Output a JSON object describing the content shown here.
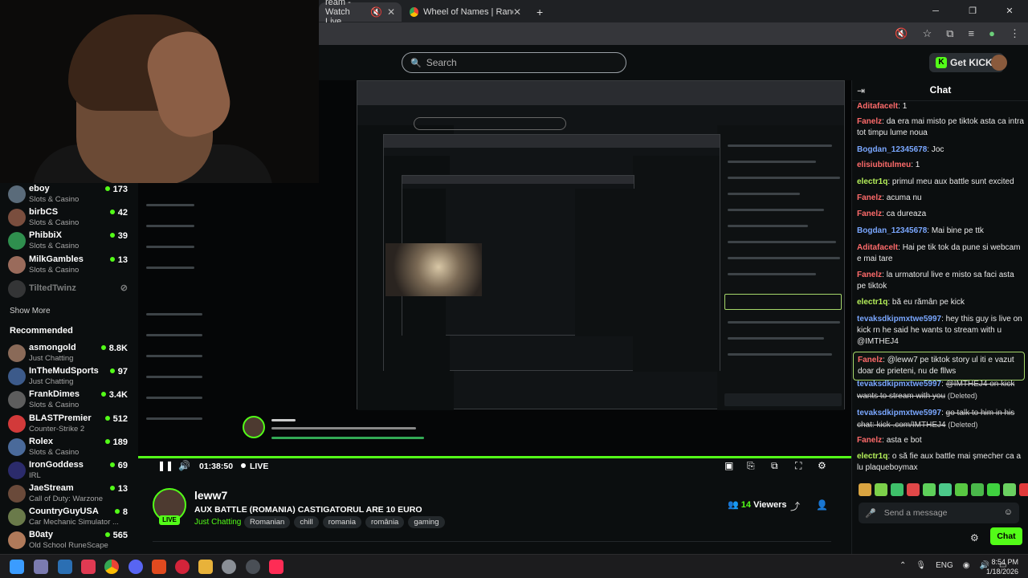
{
  "browser": {
    "tabs": [
      {
        "title": "ream - Watch Live"
      },
      {
        "title": "Wheel of Names | Random nam"
      }
    ],
    "new_tab": "+"
  },
  "header": {
    "search_placeholder": "Search",
    "kicks_label": "Get KICKs"
  },
  "sidebar": {
    "following": [
      {
        "name": "eboy",
        "category": "Slots & Casino",
        "viewers": "173",
        "color": "#5a6b7a"
      },
      {
        "name": "birbCS",
        "category": "Slots & Casino",
        "viewers": "42",
        "color": "#7a4e3e"
      },
      {
        "name": "PhibbiX",
        "category": "Slots & Casino",
        "viewers": "39",
        "color": "#2f8f4e"
      },
      {
        "name": "MilkGambles",
        "category": "Slots & Casino",
        "viewers": "13",
        "color": "#9a6b5b"
      },
      {
        "name": "TiltedTwinz",
        "category": "",
        "viewers": "",
        "color": "#444"
      }
    ],
    "show_more": "Show More",
    "recommended_title": "Recommended",
    "recommended": [
      {
        "name": "asmongold",
        "category": "Just Chatting",
        "viewers": "8.8K",
        "color": "#8a6a58"
      },
      {
        "name": "InTheMudSports",
        "category": "Just Chatting",
        "viewers": "97",
        "color": "#3c5a8a"
      },
      {
        "name": "FrankDimes",
        "category": "Slots & Casino",
        "viewers": "3.4K",
        "color": "#5d5d5d"
      },
      {
        "name": "BLASTPremier",
        "category": "Counter-Strike 2",
        "viewers": "512",
        "color": "#d23a3a"
      },
      {
        "name": "Rolex",
        "category": "Slots & Casino",
        "viewers": "189",
        "color": "#4a6a9a"
      },
      {
        "name": "IronGoddess",
        "category": "IRL",
        "viewers": "69",
        "color": "#2b2b6b"
      },
      {
        "name": "JaeStream",
        "category": "Call of Duty: Warzone",
        "viewers": "13",
        "color": "#6a4a3a"
      },
      {
        "name": "CountryGuyUSA",
        "category": "Car Mechanic Simulator ...",
        "viewers": "8",
        "color": "#6a7a4a"
      },
      {
        "name": "B0aty",
        "category": "Old School RuneScape",
        "viewers": "565",
        "color": "#b07a5a"
      }
    ]
  },
  "player": {
    "time": "01:38:50",
    "live": "LIVE"
  },
  "stream": {
    "streamer": "leww7",
    "live_badge": "LIVE",
    "title": "AUX BATTLE (ROMANIA) CASTIGATORUL ARE 10 EURO",
    "category": "Just Chatting",
    "tags": [
      "Romanian",
      "chill",
      "romania",
      "românia",
      "gaming"
    ],
    "viewers_count": "14",
    "viewers_label": "Viewers"
  },
  "chat": {
    "title": "Chat",
    "messages": [
      {
        "user": "Aditafacelt",
        "color": "#ff6b6b",
        "text": "1"
      },
      {
        "user": "Fanelz",
        "color": "#ff6b6b",
        "text": "da era mai misto pe tiktok asta ca intra tot timpu lume noua"
      },
      {
        "user": "Bogdan_12345678",
        "color": "#7aa7ff",
        "text": "Joc"
      },
      {
        "user": "elisiubitulmeu",
        "color": "#ff6b6b",
        "text": "1"
      },
      {
        "user": "electr1q",
        "color": "#b6f05a",
        "text": "primul meu aux battle sunt excited"
      },
      {
        "user": "Fanelz",
        "color": "#ff6b6b",
        "text": "acuma nu"
      },
      {
        "user": "Fanelz",
        "color": "#ff6b6b",
        "text": "ca dureaza"
      },
      {
        "user": "Bogdan_12345678",
        "color": "#7aa7ff",
        "text": "Mai bine pe ttk"
      },
      {
        "user": "Aditafacelt",
        "color": "#ff6b6b",
        "text": "Hai pe tik tok da pune si webcam e mai tare"
      },
      {
        "user": "Fanelz",
        "color": "#ff6b6b",
        "text": "la urmatorul live e misto sa faci asta pe tiktok"
      },
      {
        "user": "electr1q",
        "color": "#b6f05a",
        "text": "bă eu rămân pe kick"
      },
      {
        "user": "tevaksdkipmxtwe5997",
        "color": "#7aa7ff",
        "text": "hey this guy is live on kick rn he said he wants to stream with u @IMTHEJ4"
      },
      {
        "user": "Fanelz",
        "color": "#ff6b6b",
        "text": "@leww7 pe tiktok story ul iti e vazut doar de prieteni, nu de fllws"
      },
      {
        "user": "tevaksdkipmxtwe5997",
        "color": "#7aa7ff",
        "text": "@IMTHEJ4 on kick wants to stream with you",
        "deleted": "(Deleted)"
      },
      {
        "user": "tevaksdkipmxtwe5997",
        "color": "#7aa7ff",
        "text": "go talk to him in his chat: kick .com/IMTHEJ4",
        "deleted": "(Deleted)"
      },
      {
        "user": "Fanelz",
        "color": "#ff6b6b",
        "text": "asta e bot"
      },
      {
        "user": "electr1q",
        "color": "#b6f05a",
        "text": "o să fie aux battle mai șmecher ca a lu plaqueboymax"
      }
    ],
    "input_placeholder": "Send a message",
    "send_label": "Chat"
  },
  "taskbar": {
    "lang": "ENG",
    "time": "8:54 PM",
    "date": "1/18/2026"
  }
}
